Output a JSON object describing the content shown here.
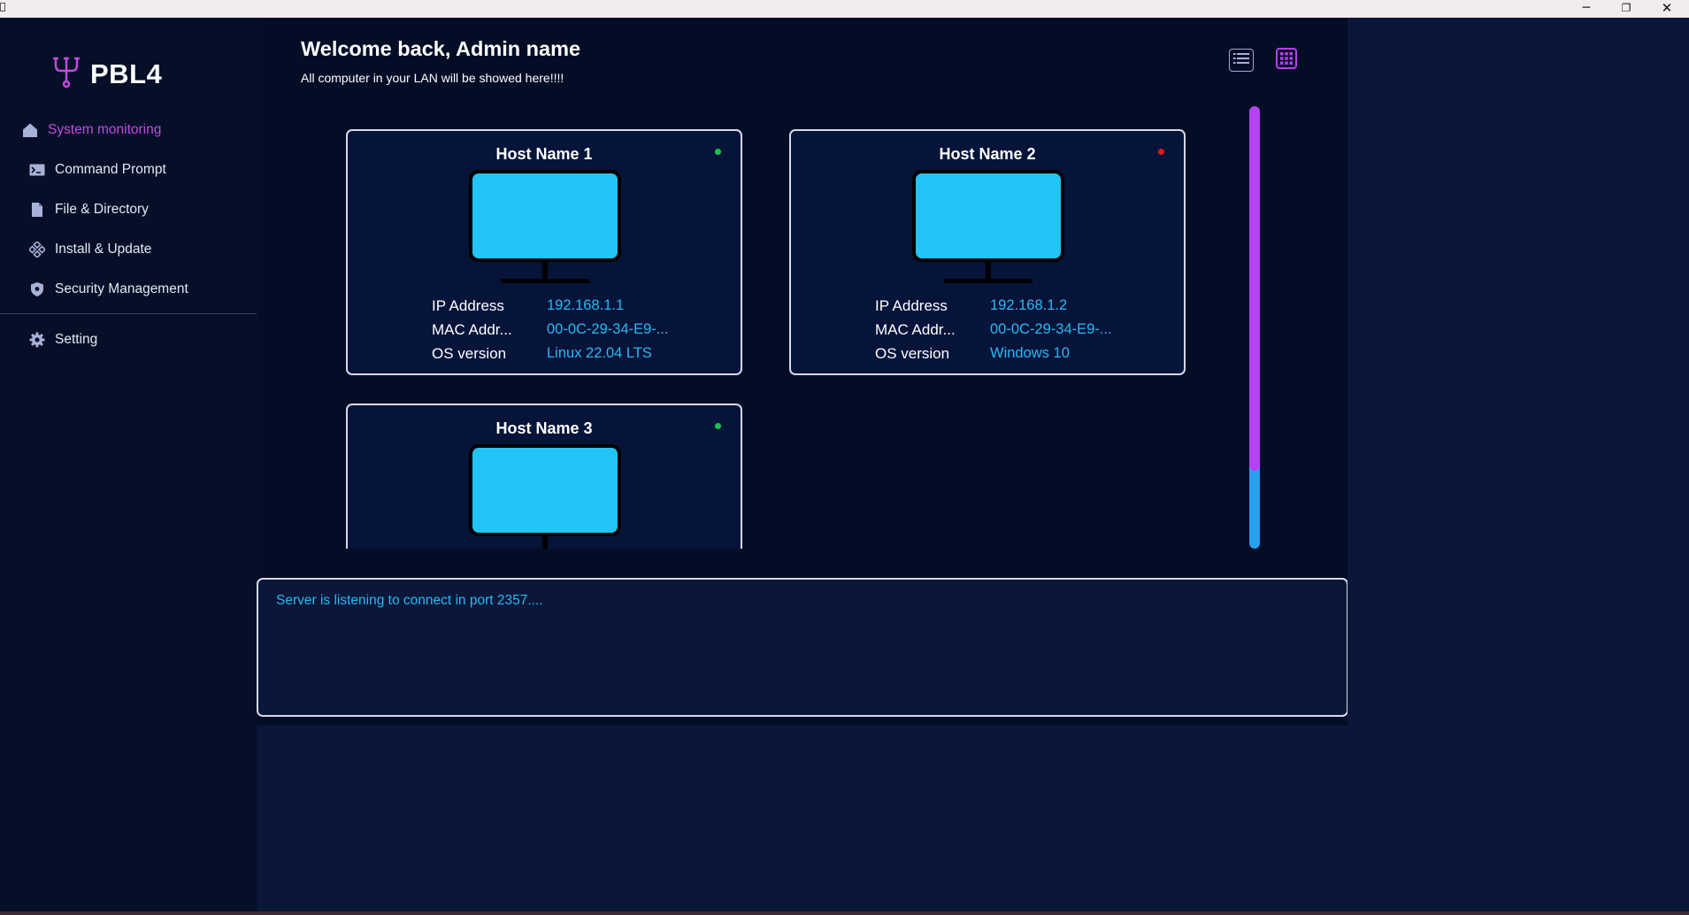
{
  "window": {
    "minimize_glyph": "─",
    "maximize_glyph": "❐",
    "close_glyph": "✕"
  },
  "app": {
    "name": "PBL4"
  },
  "sidebar": {
    "items": [
      {
        "label": "System monitoring",
        "icon": "home-icon",
        "active": true
      },
      {
        "label": "Command Prompt",
        "icon": "terminal-icon"
      },
      {
        "label": "File & Directory",
        "icon": "file-icon"
      },
      {
        "label": "Install & Update",
        "icon": "install-icon"
      },
      {
        "label": "Security Management",
        "icon": "shield-icon"
      }
    ],
    "setting": {
      "label": "Setting",
      "icon": "gear-icon"
    }
  },
  "header": {
    "welcome": "Welcome back, Admin name",
    "subtitle": "All computer in your LAN will be showed here!!!!"
  },
  "view_toggle": [
    "list-view-icon",
    "grid-view-icon"
  ],
  "field_labels": {
    "ip": "IP Address",
    "mac": "MAC Addr...",
    "os": "OS version"
  },
  "hosts": [
    {
      "name": "Host Name 1",
      "status": "online",
      "status_color": "#18c64a",
      "ip": "192.168.1.1",
      "mac": "00-0C-29-34-E9-...",
      "os": "Linux 22.04 LTS"
    },
    {
      "name": "Host Name 2",
      "status": "offline",
      "status_color": "#e51a1a",
      "ip": "192.168.1.2",
      "mac": "00-0C-29-34-E9-...",
      "os": "Windows 10"
    },
    {
      "name": "Host Name 3",
      "status": "online",
      "status_color": "#18c64a",
      "ip": "",
      "mac": "",
      "os": ""
    }
  ],
  "console": {
    "message": "Server is listening to connect in port 2357...."
  },
  "colors": {
    "accent": "#c24be0",
    "value": "#28b9f4",
    "monitor": "#22c3f7",
    "scroll_thumb": "#b640f2",
    "scroll_track": "#27a0f2"
  }
}
